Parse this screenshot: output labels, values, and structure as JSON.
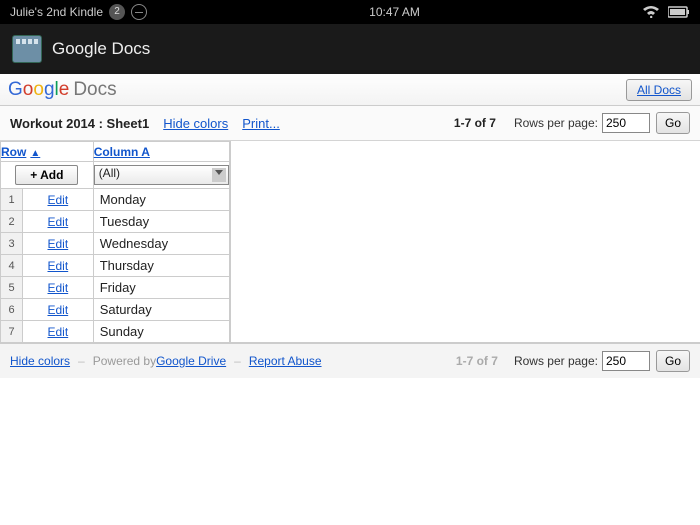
{
  "statusbar": {
    "device_name": "Julie's 2nd Kindle",
    "notif_count": "2",
    "time": "10:47 AM"
  },
  "appheader": {
    "title": "Google Docs"
  },
  "brand": {
    "docs_label": "Docs",
    "all_docs": "All Docs"
  },
  "toolbar": {
    "doc_title": "Workout 2014 : Sheet1",
    "hide_colors": "Hide colors",
    "print": "Print...",
    "range": "1-7 of 7",
    "rpp_label": "Rows per page:",
    "rpp_value": "250",
    "go": "Go"
  },
  "table": {
    "headers": {
      "row": "Row",
      "colA": "Column A"
    },
    "add_label": "+ Add",
    "filter_value": "(All)",
    "rows": [
      {
        "n": "1",
        "edit": "Edit",
        "a": "Monday"
      },
      {
        "n": "2",
        "edit": "Edit",
        "a": "Tuesday"
      },
      {
        "n": "3",
        "edit": "Edit",
        "a": "Wednesday"
      },
      {
        "n": "4",
        "edit": "Edit",
        "a": "Thursday"
      },
      {
        "n": "5",
        "edit": "Edit",
        "a": "Friday"
      },
      {
        "n": "6",
        "edit": "Edit",
        "a": "Saturday"
      },
      {
        "n": "7",
        "edit": "Edit",
        "a": "Sunday"
      }
    ]
  },
  "footer": {
    "hide_colors": "Hide colors",
    "powered": "Powered by ",
    "drive": "Google Drive",
    "report": "Report Abuse",
    "range": "1-7 of 7",
    "rpp_label": "Rows per page:",
    "rpp_value": "250",
    "go": "Go"
  }
}
